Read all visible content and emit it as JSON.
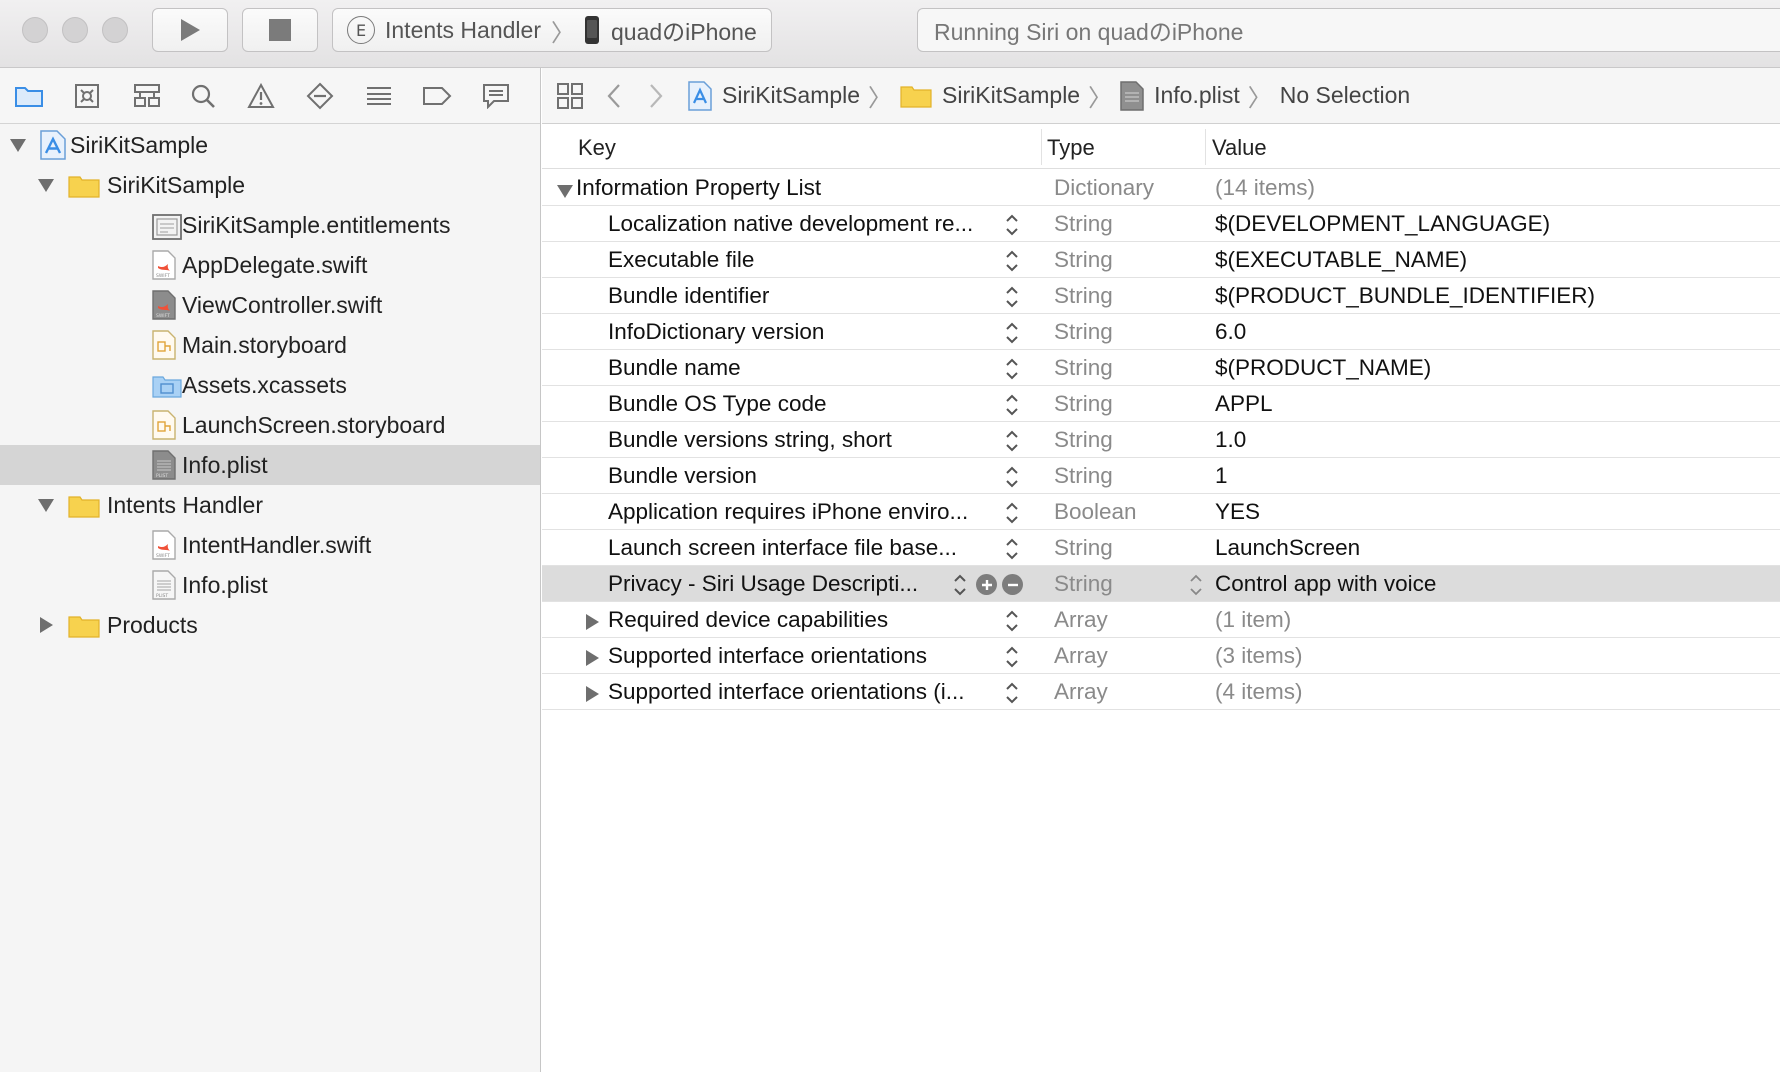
{
  "toolbar": {
    "scheme_target": "Intents Handler",
    "scheme_badge": "E",
    "scheme_device": "quadのiPhone",
    "activity_status": "Running Siri on quadのiPhone"
  },
  "navigator": {
    "tabs": [
      "project-navigator",
      "source-control",
      "symbol-navigator",
      "find-navigator",
      "issue-navigator",
      "test-navigator",
      "debug-navigator",
      "breakpoint-navigator",
      "report-navigator"
    ],
    "tree": [
      {
        "label": "SiriKitSample",
        "level": 0,
        "kind": "project",
        "expanded": true
      },
      {
        "label": "SiriKitSample",
        "level": 1,
        "kind": "folder",
        "expanded": true
      },
      {
        "label": "SiriKitSample.entitlements",
        "level": 2,
        "kind": "entitlements"
      },
      {
        "label": "AppDelegate.swift",
        "level": 2,
        "kind": "swift"
      },
      {
        "label": "ViewController.swift",
        "level": 2,
        "kind": "swift-dark"
      },
      {
        "label": "Main.storyboard",
        "level": 2,
        "kind": "storyboard"
      },
      {
        "label": "Assets.xcassets",
        "level": 2,
        "kind": "assets"
      },
      {
        "label": "LaunchScreen.storyboard",
        "level": 2,
        "kind": "storyboard"
      },
      {
        "label": "Info.plist",
        "level": 2,
        "kind": "plist-dark",
        "selected": true
      },
      {
        "label": "Intents Handler",
        "level": 1,
        "kind": "folder",
        "expanded": true
      },
      {
        "label": "IntentHandler.swift",
        "level": 2,
        "kind": "swift"
      },
      {
        "label": "Info.plist",
        "level": 2,
        "kind": "plist"
      },
      {
        "label": "Products",
        "level": 1,
        "kind": "folder",
        "expanded": false
      }
    ]
  },
  "jumpbar": {
    "crumbs": [
      "SiriKitSample",
      "SiriKitSample",
      "Info.plist",
      "No Selection"
    ]
  },
  "plist": {
    "headers": {
      "key": "Key",
      "type": "Type",
      "value": "Value"
    },
    "rows": [
      {
        "key": "Information Property List",
        "type": "Dictionary",
        "value": "(14 items)",
        "root": true,
        "muted_value": true
      },
      {
        "key": "Localization native development re...",
        "type": "String",
        "value": "$(DEVELOPMENT_LANGUAGE)"
      },
      {
        "key": "Executable file",
        "type": "String",
        "value": "$(EXECUTABLE_NAME)"
      },
      {
        "key": "Bundle identifier",
        "type": "String",
        "value": "$(PRODUCT_BUNDLE_IDENTIFIER)"
      },
      {
        "key": "InfoDictionary version",
        "type": "String",
        "value": "6.0"
      },
      {
        "key": "Bundle name",
        "type": "String",
        "value": "$(PRODUCT_NAME)"
      },
      {
        "key": "Bundle OS Type code",
        "type": "String",
        "value": "APPL"
      },
      {
        "key": "Bundle versions string, short",
        "type": "String",
        "value": "1.0"
      },
      {
        "key": "Bundle version",
        "type": "String",
        "value": "1"
      },
      {
        "key": "Application requires iPhone enviro...",
        "type": "Boolean",
        "value": "YES"
      },
      {
        "key": "Launch screen interface file base...",
        "type": "String",
        "value": "LaunchScreen"
      },
      {
        "key": "Privacy - Siri Usage Descripti...",
        "type": "String",
        "value": "Control app with voice",
        "selected": true
      },
      {
        "key": "Required device capabilities",
        "type": "Array",
        "value": "(1 item)",
        "collapsible": true,
        "muted_value": true
      },
      {
        "key": "Supported interface orientations",
        "type": "Array",
        "value": "(3 items)",
        "collapsible": true,
        "muted_value": true
      },
      {
        "key": "Supported interface orientations (i...",
        "type": "Array",
        "value": "(4 items)",
        "collapsible": true,
        "muted_value": true
      }
    ]
  },
  "colors": {
    "selection_gray": "#d5d5d5",
    "folder_yellow": "#f7d24e",
    "xcode_blue": "#3a8ee6",
    "swift_orange": "#f05138"
  }
}
